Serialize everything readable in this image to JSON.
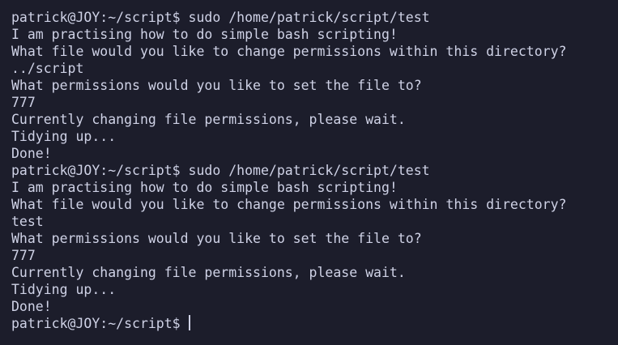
{
  "terminal": {
    "prompt": "patrick@JOY:~/script$",
    "colors": {
      "background": "#1c1d2b",
      "foreground": "#cfd2e6"
    },
    "lines": [
      "patrick@JOY:~/script$ sudo /home/patrick/script/test",
      "I am practising how to do simple bash scripting!",
      "What file would you like to change permissions within this directory?",
      "../script",
      "What permissions would you like to set the file to?",
      "777",
      "Currently changing file permissions, please wait.",
      "Tidying up...",
      "Done!",
      "patrick@JOY:~/script$ sudo /home/patrick/script/test",
      "I am practising how to do simple bash scripting!",
      "What file would you like to change permissions within this directory?",
      "test",
      "What permissions would you like to set the file to?",
      "777",
      "Currently changing file permissions, please wait.",
      "Tidying up...",
      "Done!"
    ]
  }
}
